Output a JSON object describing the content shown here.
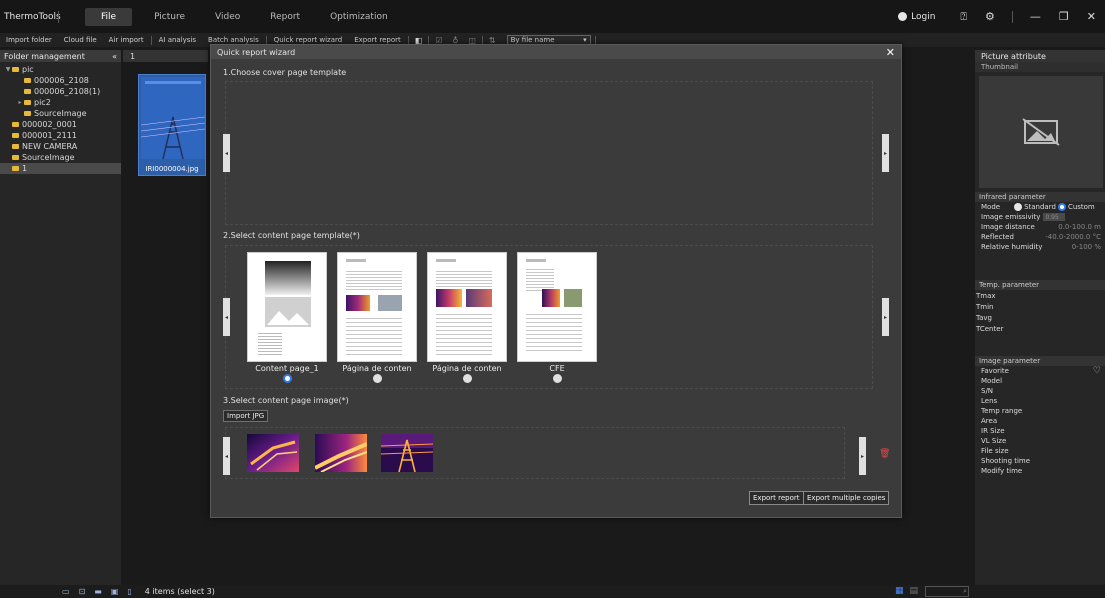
{
  "app": {
    "name": "ThermoTools"
  },
  "menu": [
    "File",
    "Picture",
    "Video",
    "Report",
    "Optimization"
  ],
  "titlebar": {
    "login": "Login"
  },
  "toolbar": {
    "items": [
      "Import folder",
      "Cloud file",
      "Air import",
      "AI analysis",
      "Batch analysis",
      "Quick report wizard",
      "Export report"
    ],
    "sort_value": "By file name"
  },
  "left_panel": {
    "title": "Folder management",
    "tree": [
      "pic",
      "000006_2108",
      "000006_2108(1)",
      "pic2",
      "SourceImage",
      "000002_0001",
      "000001_2111",
      "NEW CAMERA",
      "SourceImage",
      "1"
    ]
  },
  "center": {
    "path": "1",
    "thumbnail_label": "IRI0000004.jpg",
    "status": "4 items (select 3)"
  },
  "right_panel": {
    "title": "Picture attribute",
    "thumbnail_label": "Thumbnail",
    "infrared": {
      "title": "Infrared parameter",
      "mode_label": "Mode",
      "mode_standard": "Standard",
      "mode_custom": "Custom",
      "rows": [
        {
          "label": "Image emissivity",
          "value": "0.95"
        },
        {
          "label": "Image distance",
          "value": "0.0-100.0 m"
        },
        {
          "label": "Reflected",
          "value": "-40.0-2000.0 °C"
        },
        {
          "label": "Relative humidity",
          "value": "0-100 %"
        }
      ]
    },
    "temp": {
      "title": "Temp. parameter",
      "rows": [
        "Tmax",
        "Tmin",
        "Tavg",
        "TCenter"
      ]
    },
    "image": {
      "title": "Image parameter",
      "rows": [
        "Favorite",
        "Model",
        "S/N",
        "Lens",
        "Temp range",
        "Area",
        "IR Size",
        "VL Size",
        "File size",
        "Shooting time",
        "Modify time"
      ]
    }
  },
  "modal": {
    "title": "Quick report wizard",
    "step1": "1.Choose cover page template",
    "step2": "2.Select content page template(*)",
    "step3": "3.Select content page image(*)",
    "templates": [
      {
        "label": "Content page_1",
        "selected": true
      },
      {
        "label": "Página de conten",
        "selected": false
      },
      {
        "label": "Página de conten",
        "selected": false
      },
      {
        "label": "CFE",
        "selected": false
      }
    ],
    "import_label": "Import JPG",
    "export_label": "Export report",
    "export_multi_label": "Export multiple copies"
  }
}
